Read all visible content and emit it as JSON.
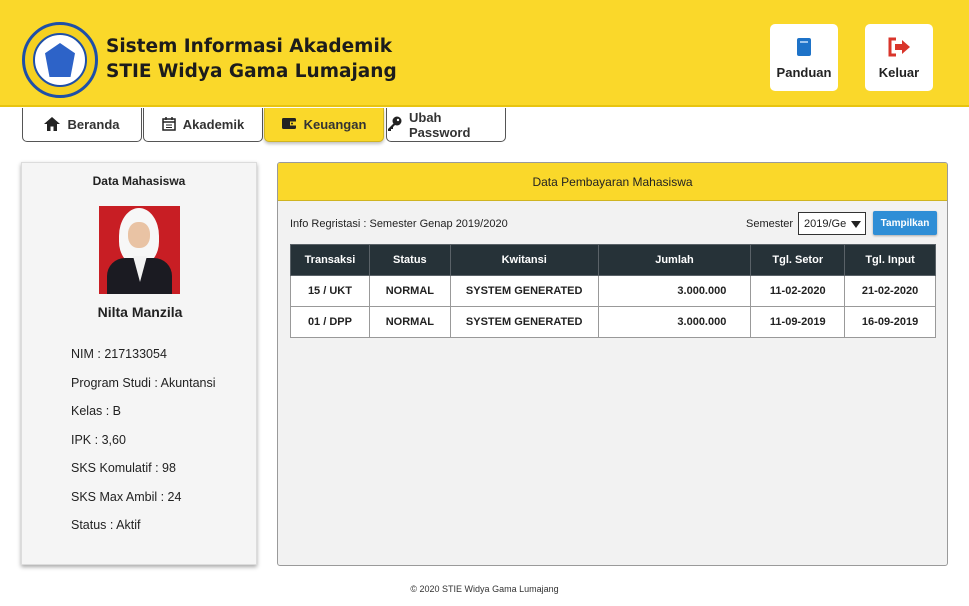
{
  "header": {
    "title_line1": "Sistem Informasi Akademik",
    "title_line2": "STIE Widya Gama Lumajang",
    "buttons": {
      "panduan": "Panduan",
      "keluar": "Keluar"
    }
  },
  "nav": {
    "tabs": [
      {
        "label": "Beranda",
        "icon": "home-icon"
      },
      {
        "label": "Akademik",
        "icon": "calendar-icon"
      },
      {
        "label": "Keuangan",
        "icon": "wallet-icon",
        "active": true
      },
      {
        "label": "Ubah Password",
        "icon": "key-icon"
      }
    ]
  },
  "student": {
    "card_title": "Data Mahasiswa",
    "name": "Nilta Manzila",
    "fields": [
      "NIM : 217133054",
      "Program Studi : Akuntansi",
      "Kelas : B",
      "IPK : 3,60",
      "SKS Komulatif : 98",
      "SKS Max Ambil : 24",
      "Status : Aktif"
    ]
  },
  "payment": {
    "panel_title": "Data Pembayaran Mahasiswa",
    "reg_info": "Info Regristasi : Semester Genap 2019/2020",
    "semester_label": "Semester",
    "semester_value": "2019/Ge",
    "show_button": "Tampilkan",
    "columns": [
      "Transaksi",
      "Status",
      "Kwitansi",
      "Jumlah",
      "Tgl. Setor",
      "Tgl. Input"
    ],
    "rows": [
      [
        "15 / UKT",
        "NORMAL",
        "SYSTEM GENERATED",
        "3.000.000",
        "11-02-2020",
        "21-02-2020"
      ],
      [
        "01 / DPP",
        "NORMAL",
        "SYSTEM GENERATED",
        "3.000.000",
        "11-09-2019",
        "16-09-2019"
      ]
    ]
  },
  "footer": {
    "text": "2020 STIE Widya Gama Lumajang"
  },
  "colors": {
    "accent": "#fad82a",
    "table_header": "#263238",
    "button_blue": "#2f8ed6",
    "logout_red": "#d9352b",
    "book_blue": "#1e73c8"
  }
}
